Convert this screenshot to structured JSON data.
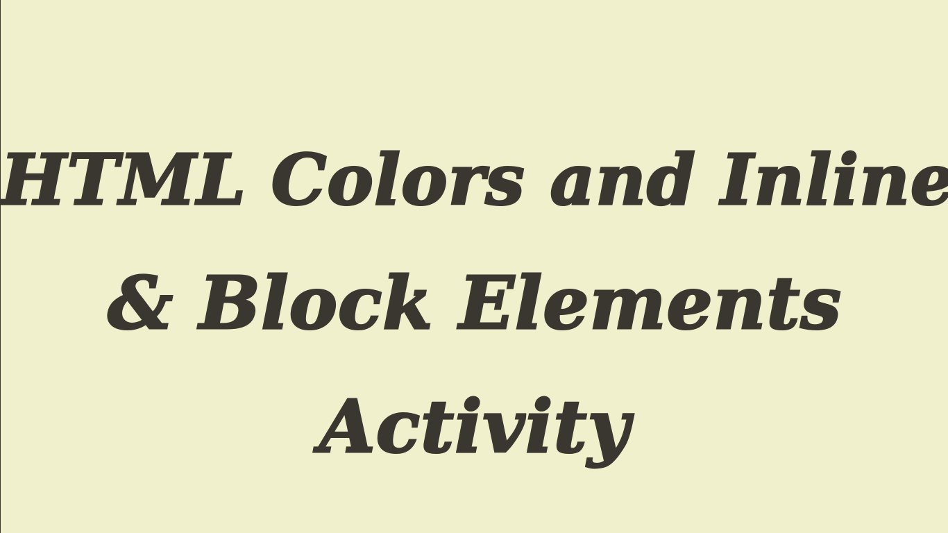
{
  "slide": {
    "title_lines": [
      "HTML Colors and Inline",
      "& Block Elements",
      "Activity"
    ]
  },
  "colors": {
    "background": "#f0f0cc",
    "text": "#3a3630"
  }
}
